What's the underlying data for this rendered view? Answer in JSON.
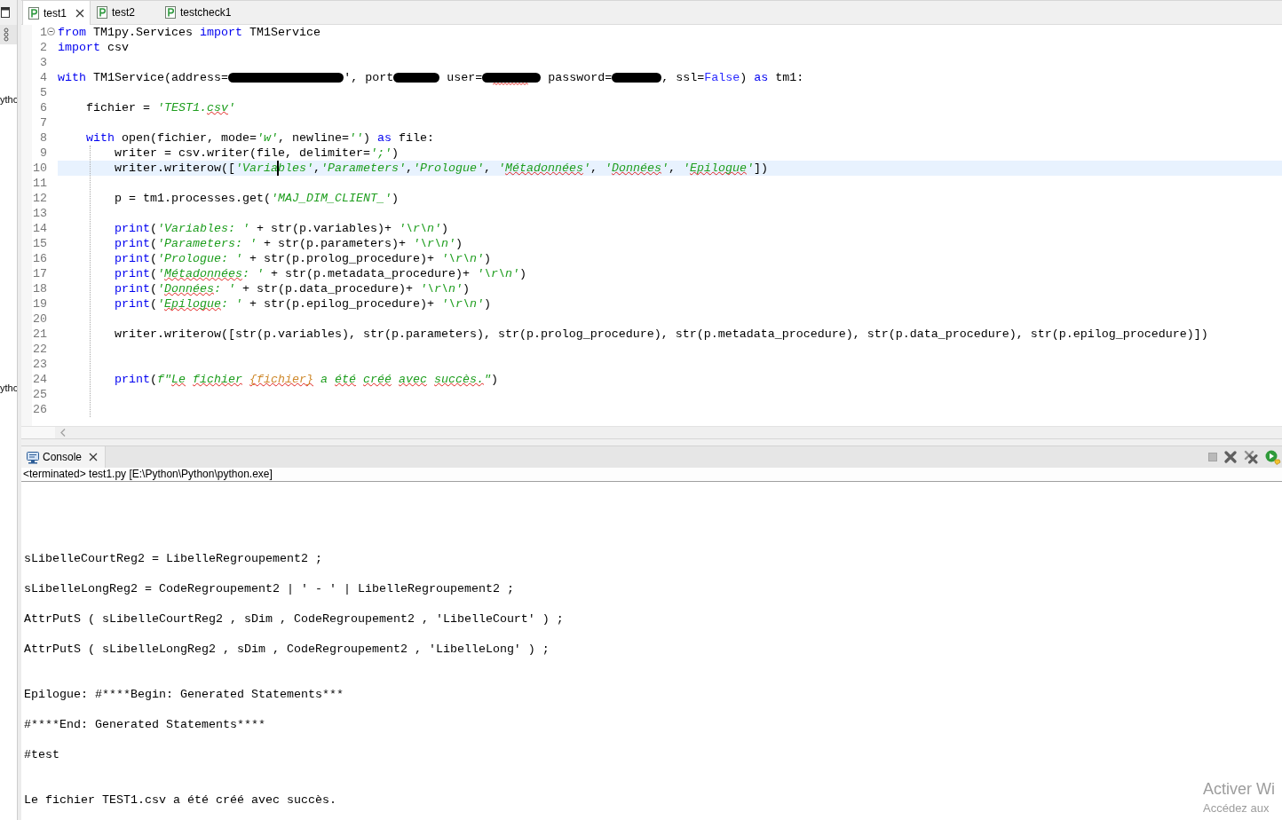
{
  "side_panel": {
    "labels": [
      "ythc",
      "ythc"
    ]
  },
  "editor": {
    "tabs": [
      {
        "label": "test1",
        "selected": true
      },
      {
        "label": "test2",
        "selected": false
      },
      {
        "label": "testcheck1",
        "selected": false
      }
    ],
    "lines": [
      {
        "number": "1",
        "current": false,
        "expanded": true,
        "segments": [
          {
            "kind": "keyword",
            "text": "from"
          },
          {
            "kind": "plain",
            "text": " TM1py.Services "
          },
          {
            "kind": "keyword",
            "text": "import"
          },
          {
            "kind": "plain",
            "text": " TM1Service"
          }
        ]
      },
      {
        "number": "2",
        "current": false,
        "segments": [
          {
            "kind": "keyword",
            "text": "import"
          },
          {
            "kind": "plain",
            "text": " csv"
          }
        ]
      },
      {
        "number": "3",
        "current": false
      },
      {
        "number": "4",
        "current": false,
        "segments": [
          {
            "kind": "keyword",
            "text": "with"
          },
          {
            "kind": "plain",
            "text": " TM1Service(address="
          },
          {
            "kind": "redacted"
          },
          {
            "kind": "plain",
            "text": "', port"
          },
          {
            "kind": "redacted"
          },
          {
            "kind": "plain",
            "text": " user="
          },
          {
            "kind": "redacted",
            "misspelled": true
          },
          {
            "kind": "plain",
            "text": " password="
          },
          {
            "kind": "redacted"
          },
          {
            "kind": "plain",
            "text": ", ssl="
          },
          {
            "kind": "constant",
            "text": "False"
          },
          {
            "kind": "plain",
            "text": ") "
          },
          {
            "kind": "keyword",
            "text": "as"
          },
          {
            "kind": "plain",
            "text": " tm1:"
          }
        ]
      },
      {
        "number": "5",
        "current": false
      },
      {
        "number": "6",
        "current": false,
        "segments": [
          {
            "kind": "plain",
            "text": "    fichier = "
          },
          {
            "kind": "string",
            "text": "'TEST1."
          },
          {
            "kind": "string",
            "text": "csv",
            "misspelled": true
          },
          {
            "kind": "string",
            "text": "'"
          }
        ]
      },
      {
        "number": "7",
        "current": false
      },
      {
        "number": "8",
        "current": false,
        "segments": [
          {
            "kind": "keyword",
            "text": "    with"
          },
          {
            "kind": "plain",
            "text": " open(fichier, mode="
          },
          {
            "kind": "string",
            "text": "'w'"
          },
          {
            "kind": "plain",
            "text": ", newline="
          },
          {
            "kind": "string",
            "text": "''"
          },
          {
            "kind": "plain",
            "text": ") "
          },
          {
            "kind": "keyword",
            "text": "as"
          },
          {
            "kind": "plain",
            "text": " file:"
          }
        ]
      },
      {
        "number": "9",
        "current": false,
        "segments": [
          {
            "kind": "plain",
            "text": "        writer = csv.writer(file, delimiter="
          },
          {
            "kind": "string",
            "text": "';'"
          },
          {
            "kind": "plain",
            "text": ")"
          }
        ]
      },
      {
        "number": "10",
        "current": true,
        "segments": [
          {
            "kind": "plain",
            "text": "        writer.writerow(["
          },
          {
            "kind": "string",
            "text": "'Varia"
          },
          {
            "kind": "caret"
          },
          {
            "kind": "string",
            "text": "bles'"
          },
          {
            "kind": "plain",
            "text": ","
          },
          {
            "kind": "string",
            "text": "'Parameters'"
          },
          {
            "kind": "plain",
            "text": ","
          },
          {
            "kind": "string",
            "text": "'Prologue'"
          },
          {
            "kind": "plain",
            "text": ", "
          },
          {
            "kind": "string",
            "text": "'"
          },
          {
            "kind": "string",
            "text": "Métadonnées",
            "misspelled": true
          },
          {
            "kind": "string",
            "text": "'"
          },
          {
            "kind": "plain",
            "text": ", "
          },
          {
            "kind": "string",
            "text": "'"
          },
          {
            "kind": "string",
            "text": "Données",
            "misspelled": true
          },
          {
            "kind": "string",
            "text": "'"
          },
          {
            "kind": "plain",
            "text": ", "
          },
          {
            "kind": "string",
            "text": "'"
          },
          {
            "kind": "string",
            "text": "Epilogue",
            "misspelled": true
          },
          {
            "kind": "string",
            "text": "'"
          },
          {
            "kind": "plain",
            "text": "])"
          }
        ]
      },
      {
        "number": "11",
        "current": false
      },
      {
        "number": "12",
        "current": false,
        "segments": [
          {
            "kind": "plain",
            "text": "        p = tm1.processes.get("
          },
          {
            "kind": "string",
            "text": "'MAJ_DIM_CLIENT_'"
          },
          {
            "kind": "plain",
            "text": ")"
          }
        ]
      },
      {
        "number": "13",
        "current": false
      },
      {
        "number": "14",
        "current": false,
        "segments": [
          {
            "kind": "keyword",
            "text": "        print"
          },
          {
            "kind": "plain",
            "text": "("
          },
          {
            "kind": "string",
            "text": "'Variables: '"
          },
          {
            "kind": "plain",
            "text": " + str(p.variables)+ "
          },
          {
            "kind": "string",
            "text": "'\\r\\n'"
          },
          {
            "kind": "plain",
            "text": ")"
          }
        ]
      },
      {
        "number": "15",
        "current": false,
        "segments": [
          {
            "kind": "keyword",
            "text": "        print"
          },
          {
            "kind": "plain",
            "text": "("
          },
          {
            "kind": "string",
            "text": "'Parameters: '"
          },
          {
            "kind": "plain",
            "text": " + str(p.parameters)+ "
          },
          {
            "kind": "string",
            "text": "'\\r\\n'"
          },
          {
            "kind": "plain",
            "text": ")"
          }
        ]
      },
      {
        "number": "16",
        "current": false,
        "segments": [
          {
            "kind": "keyword",
            "text": "        print"
          },
          {
            "kind": "plain",
            "text": "("
          },
          {
            "kind": "string",
            "text": "'Prologue: '"
          },
          {
            "kind": "plain",
            "text": " + str(p.prolog_procedure)+ "
          },
          {
            "kind": "string",
            "text": "'\\r\\n'"
          },
          {
            "kind": "plain",
            "text": ")"
          }
        ]
      },
      {
        "number": "17",
        "current": false,
        "segments": [
          {
            "kind": "keyword",
            "text": "        print"
          },
          {
            "kind": "plain",
            "text": "("
          },
          {
            "kind": "string",
            "text": "'"
          },
          {
            "kind": "string",
            "text": "Métadonnées",
            "misspelled": true
          },
          {
            "kind": "string",
            "text": ": '"
          },
          {
            "kind": "plain",
            "text": " + str(p.metadata_procedure)+ "
          },
          {
            "kind": "string",
            "text": "'\\r\\n'"
          },
          {
            "kind": "plain",
            "text": ")"
          }
        ]
      },
      {
        "number": "18",
        "current": false,
        "segments": [
          {
            "kind": "keyword",
            "text": "        print"
          },
          {
            "kind": "plain",
            "text": "("
          },
          {
            "kind": "string",
            "text": "'"
          },
          {
            "kind": "string",
            "text": "Données",
            "misspelled": true
          },
          {
            "kind": "string",
            "text": ": '"
          },
          {
            "kind": "plain",
            "text": " + str(p.data_procedure)+ "
          },
          {
            "kind": "string",
            "text": "'\\r\\n'"
          },
          {
            "kind": "plain",
            "text": ")"
          }
        ]
      },
      {
        "number": "19",
        "current": false,
        "segments": [
          {
            "kind": "keyword",
            "text": "        print"
          },
          {
            "kind": "plain",
            "text": "("
          },
          {
            "kind": "string",
            "text": "'"
          },
          {
            "kind": "string",
            "text": "Epilogue",
            "misspelled": true
          },
          {
            "kind": "string",
            "text": ": '"
          },
          {
            "kind": "plain",
            "text": " + str(p.epilog_procedure)+ "
          },
          {
            "kind": "string",
            "text": "'\\r\\n'"
          },
          {
            "kind": "plain",
            "text": ")"
          }
        ]
      },
      {
        "number": "20",
        "current": false
      },
      {
        "number": "21",
        "current": false,
        "segments": [
          {
            "kind": "plain",
            "text": "        writer.writerow([str(p.variables), str(p.parameters), str(p.prolog_procedure), str(p.metadata_procedure), str(p.data_procedure), str(p.epilog_procedure)])"
          }
        ]
      },
      {
        "number": "22",
        "current": false
      },
      {
        "number": "23",
        "current": false
      },
      {
        "number": "24",
        "current": false,
        "segments": [
          {
            "kind": "keyword",
            "text": "        print"
          },
          {
            "kind": "plain",
            "text": "("
          },
          {
            "kind": "string",
            "text": "f\""
          },
          {
            "kind": "string",
            "text": "Le fichier ",
            "misspelled": true
          },
          {
            "kind": "interpolation",
            "text": "{fichier}",
            "misspelled": true
          },
          {
            "kind": "string",
            "text": " a "
          },
          {
            "kind": "string",
            "text": "été créé avec succès.",
            "misspelled": true
          },
          {
            "kind": "string",
            "text": "\""
          },
          {
            "kind": "plain",
            "text": ")"
          }
        ]
      },
      {
        "number": "25",
        "current": false
      },
      {
        "number": "26",
        "current": false
      }
    ]
  },
  "console": {
    "tab": {
      "label": "Console",
      "selected": true
    },
    "toolbar": [
      {
        "kind": "stop",
        "disabled": true
      },
      {
        "kind": "remove",
        "disabled": false
      },
      {
        "kind": "remove-all",
        "disabled": false
      },
      {
        "kind": "run",
        "disabled": false
      }
    ],
    "status": "<terminated> test1.py [E:\\Python\\Python\\python.exe]",
    "output_blocks": [
      {
        "lines": [
          "sLibelleCourtReg2 = LibelleRegroupement2 ;",
          "sLibelleLongReg2 = CodeRegroupement2 | ' - ' | LibelleRegroupement2 ;",
          "AttrPutS ( sLibelleCourtReg2 , sDim , CodeRegroupement2 , 'LibelleCourt' ) ;",
          "AttrPutS ( sLibelleLongReg2 , sDim , CodeRegroupement2 , 'LibelleLong' ) ;"
        ]
      },
      {
        "lines": [
          "Epilogue: #****Begin: Generated Statements***",
          "#****End: Generated Statements****",
          "#test"
        ]
      },
      {
        "lines": [
          "Le fichier TEST1.csv a été créé avec succès."
        ]
      }
    ]
  },
  "watermark": {
    "title": "Activer Wi",
    "subtitle": "Accédez aux"
  }
}
